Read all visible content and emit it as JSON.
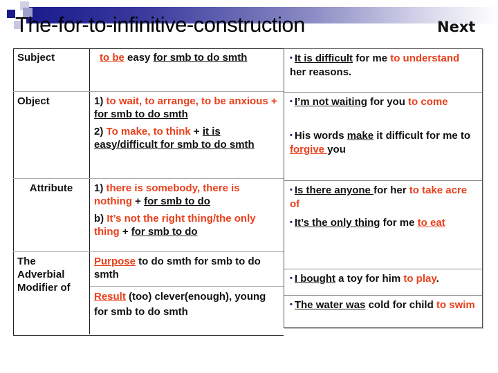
{
  "header": {
    "title": "The-for-to-infinitive-construction",
    "next_label": "Next"
  },
  "colors": {
    "accent_red": "#e8401c",
    "banner_navy": "#1a1a8c",
    "bullet": "#1a1a6c"
  },
  "left_table": {
    "rows": [
      {
        "label": "Subject",
        "lines": [
          [
            {
              "t": "to be",
              "style": "red-u"
            },
            {
              "t": " easy ",
              "style": "plain"
            },
            {
              "t": "for smb to do smth",
              "style": "u"
            }
          ]
        ]
      },
      {
        "label": "Object",
        "lines": [
          [
            {
              "t": "1) ",
              "style": "plain"
            },
            {
              "t": "to wait, to arrange, to be anxious +",
              "style": "red"
            },
            {
              "t": " ",
              "style": "plain"
            },
            {
              "t": "for smb to do smth",
              "style": "u"
            }
          ],
          [
            {
              "t": "2) ",
              "style": "plain"
            },
            {
              "t": "To make, to think",
              "style": "red"
            },
            {
              "t": " + ",
              "style": "plain"
            },
            {
              "t": "it is easy/difficult for smb to do smth ",
              "style": "u"
            }
          ]
        ]
      },
      {
        "label": "Attribute",
        "lines": [
          [
            {
              "t": "1) ",
              "style": "plain"
            },
            {
              "t": "there is  somebody, there is nothing",
              "style": "red"
            },
            {
              "t": " + ",
              "style": "plain"
            },
            {
              "t": "for smb to do",
              "style": "u"
            }
          ],
          [
            {
              "t": "b) ",
              "style": "plain"
            },
            {
              "t": "It’s  not the right thing/the only thing",
              "style": "red"
            },
            {
              "t": " + ",
              "style": "plain"
            },
            {
              "t": "for smb to do",
              "style": "u"
            }
          ]
        ]
      },
      {
        "label": "The Adverbial Modifier of",
        "sub": [
          {
            "lines": [
              [
                {
                  "t": "Purpose",
                  "style": "red-u"
                },
                {
                  "t": " to do smth for smb to do smth",
                  "style": "plain"
                }
              ]
            ]
          },
          {
            "lines": [
              [
                {
                  "t": "Result",
                  "style": "red-u"
                },
                {
                  "t": "  (too) clever(enough), young for smb to do smth",
                  "style": "plain"
                }
              ]
            ]
          }
        ]
      }
    ]
  },
  "right_examples": [
    [
      {
        "t": "It is difficult",
        "style": "u"
      },
      {
        "t": " for me ",
        "style": "plain"
      },
      {
        "t": "to understand",
        "style": "red"
      },
      {
        "t": " her reasons.",
        "style": "plain"
      }
    ],
    [
      {
        "t": "I’m not waiting",
        "style": "u"
      },
      {
        "t": " for you ",
        "style": "plain"
      },
      {
        "t": "to come",
        "style": "red"
      }
    ],
    [
      {
        "t": "His words ",
        "style": "plain"
      },
      {
        "t": "make",
        "style": "u"
      },
      {
        "t": " it difficult for me to ",
        "style": "plain"
      },
      {
        "t": "forgive ",
        "style": "red-u"
      },
      {
        "t": "you",
        "style": "plain"
      }
    ],
    [
      {
        "t": "Is there anyone ",
        "style": "u"
      },
      {
        "t": " for her ",
        "style": "plain"
      },
      {
        "t": "to take acre of",
        "style": "red"
      }
    ],
    [
      {
        "t": "It’s the only thing",
        "style": "u"
      },
      {
        "t": " for me ",
        "style": "plain"
      },
      {
        "t": "to eat ",
        "style": "red-u"
      }
    ],
    [
      {
        "t": "I bought",
        "style": "u"
      },
      {
        "t": " a toy for him ",
        "style": "plain"
      },
      {
        "t": "to play",
        "style": "red"
      },
      {
        "t": ".",
        "style": "plain"
      }
    ],
    [
      {
        "t": "The water was",
        "style": "u"
      },
      {
        "t": " cold for child ",
        "style": "plain"
      },
      {
        "t": "to swim",
        "style": "red"
      }
    ]
  ]
}
